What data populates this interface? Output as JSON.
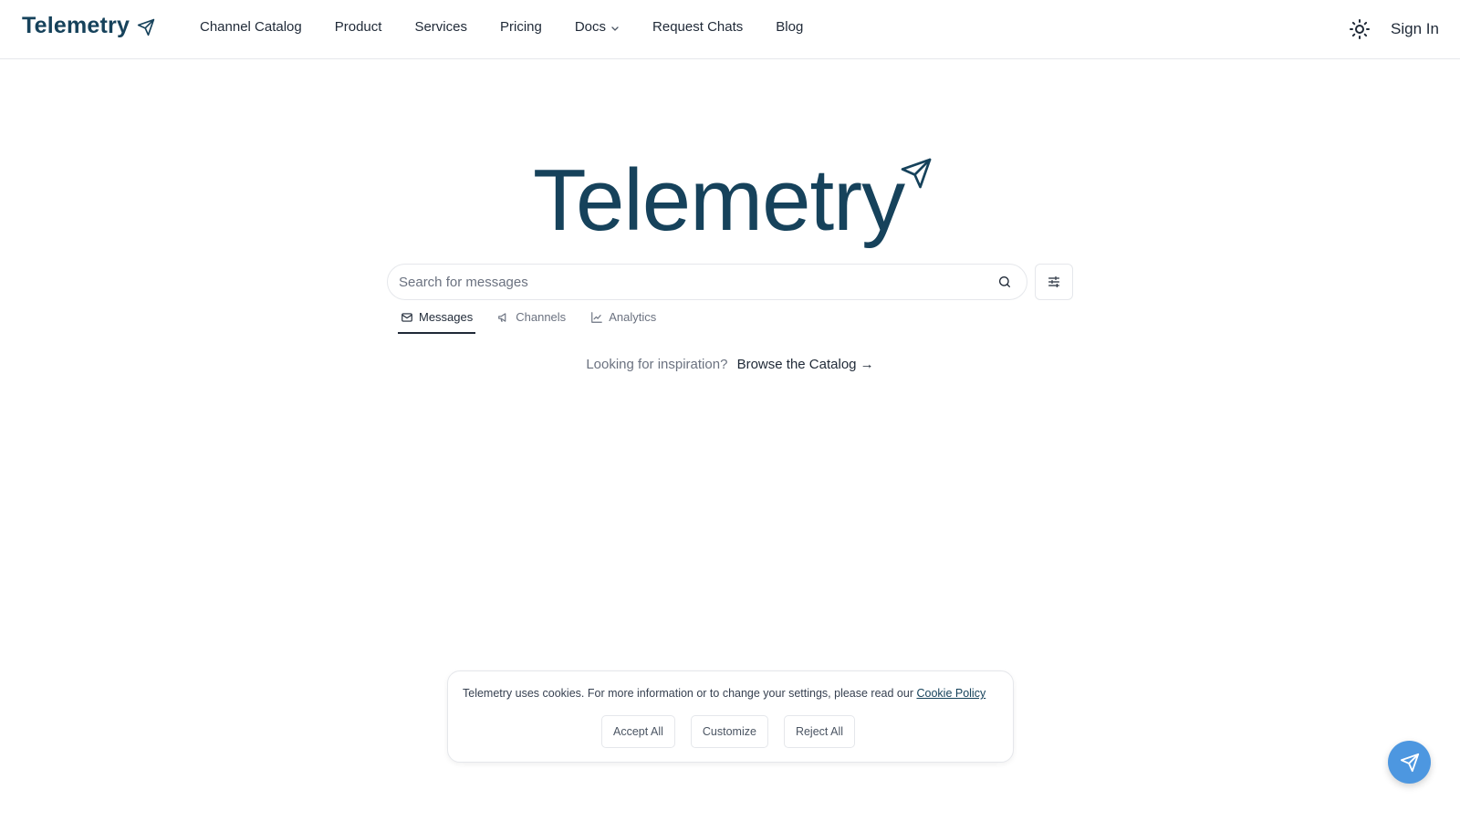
{
  "brand": {
    "name": "Telemetry",
    "icon": "paper-plane-icon",
    "color": "#16425b"
  },
  "nav": {
    "items": [
      {
        "label": "Channel Catalog"
      },
      {
        "label": "Product"
      },
      {
        "label": "Services"
      },
      {
        "label": "Pricing"
      },
      {
        "label": "Docs",
        "has_dropdown": true
      },
      {
        "label": "Request Chats"
      },
      {
        "label": "Blog"
      }
    ],
    "theme_icon": "sun-icon",
    "sign_in_label": "Sign In"
  },
  "hero": {
    "title": "Telemetry",
    "icon": "paper-plane-icon"
  },
  "search": {
    "placeholder": "Search for messages",
    "value": "",
    "icon": "search-icon",
    "filter_icon": "sliders-icon"
  },
  "tabs": [
    {
      "label": "Messages",
      "icon": "envelope-icon",
      "active": true
    },
    {
      "label": "Channels",
      "icon": "megaphone-icon",
      "active": false
    },
    {
      "label": "Analytics",
      "icon": "chart-line-icon",
      "active": false
    }
  ],
  "inspiration": {
    "question": "Looking for inspiration?",
    "link_label": "Browse the Catalog →"
  },
  "cookie": {
    "text": "Telemetry uses cookies. For more information or to change your settings, please read our",
    "link_label": "Cookie Policy",
    "buttons": {
      "accept": "Accept All",
      "customize": "Customize",
      "reject": "Reject All"
    }
  },
  "fab": {
    "icon": "paper-plane-icon",
    "color": "#4d97e0"
  },
  "colors": {
    "accent": "#16425b",
    "text": "#1f2937",
    "muted": "#6b7280",
    "border": "#e5e7eb"
  }
}
